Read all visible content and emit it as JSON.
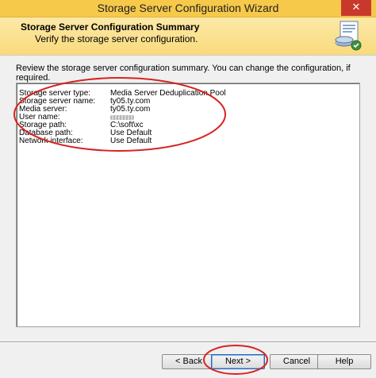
{
  "window": {
    "title": "Storage Server Configuration Wizard",
    "close_glyph": "✕"
  },
  "header": {
    "title": "Storage Server Configuration Summary",
    "subtitle": "Verify the storage server configuration."
  },
  "instruction": "Review the storage server configuration summary. You can change the configuration, if required.",
  "summary": {
    "rows": [
      {
        "label": "Storage server type:",
        "value": "Media Server Deduplication Pool"
      },
      {
        "label": "Storage server name:",
        "value": "ty05.ty.com"
      },
      {
        "label": "Media server:",
        "value": "ty05.ty.com"
      },
      {
        "label": "User name:",
        "value": ""
      },
      {
        "label": "Storage path:",
        "value": "C:\\soft\\xc"
      },
      {
        "label": "Database path:",
        "value": "Use Default"
      },
      {
        "label": "Network interface:",
        "value": "Use Default"
      }
    ]
  },
  "buttons": {
    "back": "< Back",
    "next": "Next >",
    "cancel": "Cancel",
    "help": "Help"
  },
  "colors": {
    "titlebar": "#f6c94a",
    "close": "#c9392b",
    "annotation": "#d8231f"
  },
  "icons": {
    "header": "wizard-disk-icon",
    "close": "close-icon"
  }
}
